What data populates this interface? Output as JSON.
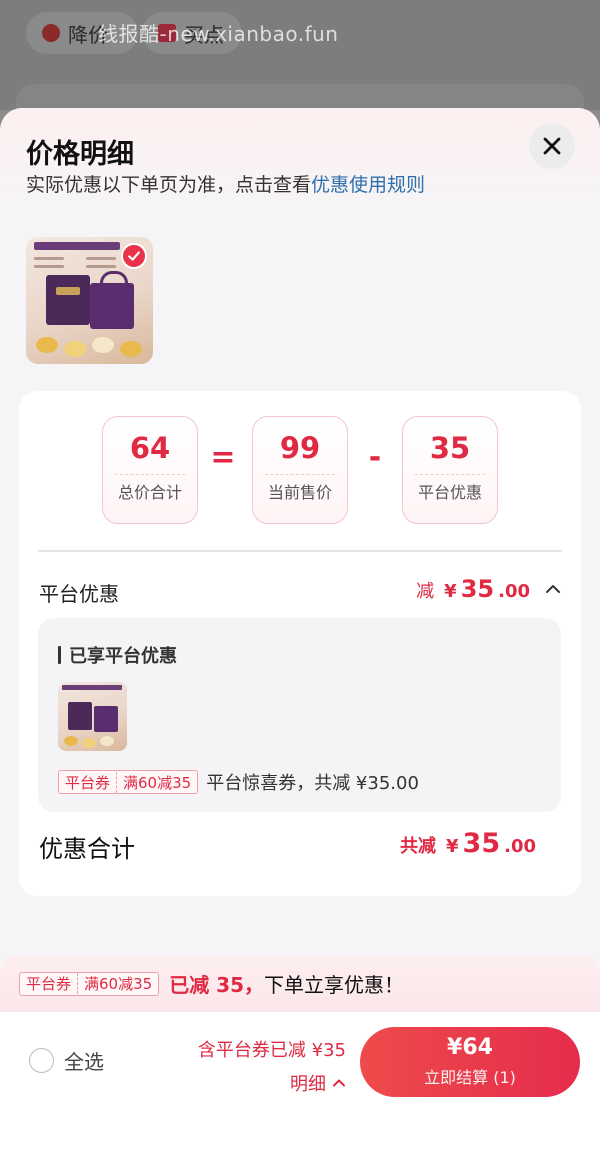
{
  "background": {
    "pill_1_label": "降价",
    "pill_2_label": "买点",
    "watermark": "线报酷-new.xianbao.fun"
  },
  "sheet": {
    "title": "价格明细",
    "subtitle_prefix": "实际优惠以下单页为准，点击查看",
    "subtitle_link": "优惠使用规则"
  },
  "formula": {
    "total_value": "64",
    "total_label": "总价合计",
    "equals": "=",
    "current_value": "99",
    "current_label": "当前售价",
    "minus": "-",
    "discount_value": "35",
    "discount_label": "平台优惠"
  },
  "platform_discount": {
    "label": "平台优惠",
    "prefix": "减",
    "currency": "¥",
    "amount_int": "35",
    "amount_dec": ".00"
  },
  "enjoyed": {
    "title": "已享平台优惠",
    "coupon_tag_left": "平台券",
    "coupon_tag_right": "满60减35",
    "coupon_desc": "平台惊喜券，共减 ¥35.00"
  },
  "total_discount": {
    "label": "优惠合计",
    "prefix": "共减",
    "currency": "¥",
    "amount_int": "35",
    "amount_dec": ".00"
  },
  "promo": {
    "tag_left": "平台券",
    "tag_right": "满60减35",
    "highlight": "已减 35，",
    "text": "下单立享优惠！"
  },
  "footer": {
    "select_all": "全选",
    "summary_line1": "含平台券已减 ¥35",
    "summary_line2": "明细",
    "checkout_amount": "¥64",
    "checkout_label": "立即结算 (1)"
  },
  "colors": {
    "accent": "#e02a43",
    "link": "#2e6fae",
    "checkout_start": "#ee4b4b",
    "checkout_end": "#e52c4c"
  },
  "icons": {
    "close": "close-icon",
    "check": "check-icon",
    "expand": "chevron-up-icon"
  }
}
